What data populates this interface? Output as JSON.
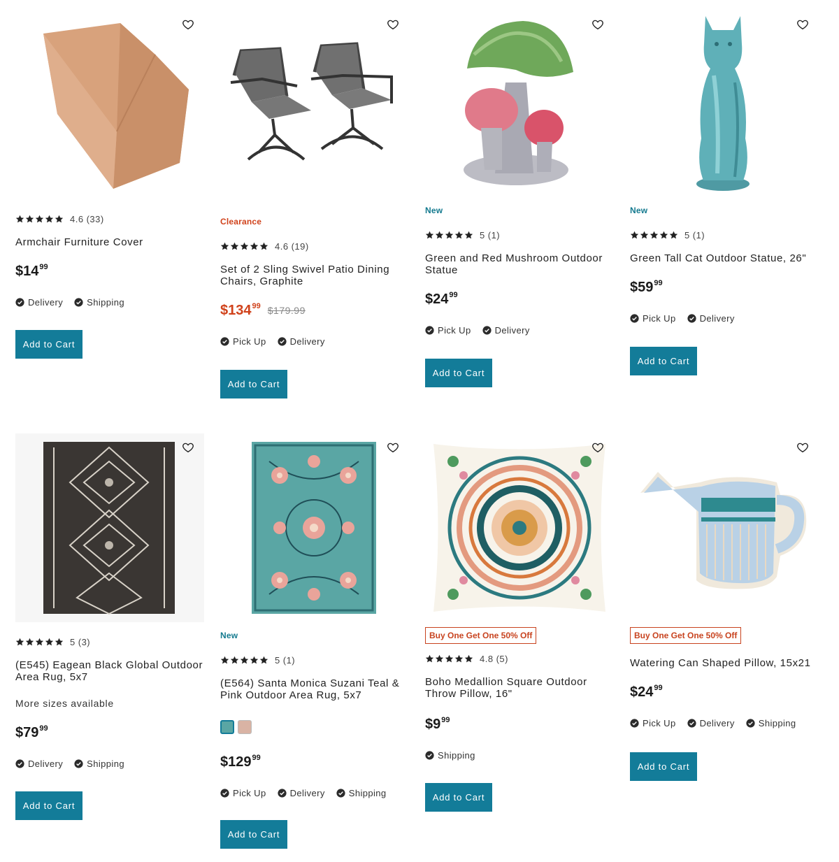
{
  "colors": {
    "accent": "#137c99",
    "sale": "#d0421b",
    "new": "#147a8f",
    "star": "#222222"
  },
  "icons": {
    "wishlist": "heart-outline-icon",
    "fulfillment": "check-circle-icon",
    "rating": "star-icon"
  },
  "products": [
    {
      "id": "armchair-cover",
      "badge": "",
      "rating": "4.6",
      "reviews": "(33)",
      "stars": 4.6,
      "title": "Armchair Furniture Cover",
      "more": "",
      "price_dollar": "$",
      "price_whole": "14",
      "price_cents": "99",
      "was": "",
      "fulfillment": [
        "Delivery",
        "Shipping"
      ],
      "button": "Add to Cart"
    },
    {
      "id": "swivel-chairs",
      "badge": "Clearance",
      "rating": "4.6",
      "reviews": "(19)",
      "stars": 4.6,
      "title": "Set of 2 Sling Swivel Patio Dining Chairs, Graphite",
      "more": "",
      "price_dollar": "$",
      "price_whole": "134",
      "price_cents": "99",
      "was": "$179.99",
      "fulfillment": [
        "Pick Up",
        "Delivery"
      ],
      "button": "Add to Cart"
    },
    {
      "id": "mushroom-statue",
      "badge": "New",
      "rating": "5",
      "reviews": "(1)",
      "stars": 5,
      "title": "Green and Red Mushroom Outdoor Statue",
      "more": "",
      "price_dollar": "$",
      "price_whole": "24",
      "price_cents": "99",
      "was": "",
      "fulfillment": [
        "Pick Up",
        "Delivery"
      ],
      "button": "Add to Cart"
    },
    {
      "id": "cat-statue",
      "badge": "New",
      "rating": "5",
      "reviews": "(1)",
      "stars": 5,
      "title": "Green Tall Cat Outdoor Statue, 26\"",
      "more": "",
      "price_dollar": "$",
      "price_whole": "59",
      "price_cents": "99",
      "was": "",
      "fulfillment": [
        "Pick Up",
        "Delivery"
      ],
      "button": "Add to Cart"
    },
    {
      "id": "eagean-rug",
      "badge": "",
      "rating": "5",
      "reviews": "(3)",
      "stars": 5,
      "title": "(E545) Eagean Black Global Outdoor Area Rug, 5x7",
      "more": "More sizes available",
      "price_dollar": "$",
      "price_whole": "79",
      "price_cents": "99",
      "was": "",
      "fulfillment": [
        "Delivery",
        "Shipping"
      ],
      "button": "Add to Cart"
    },
    {
      "id": "suzani-rug",
      "badge": "New",
      "rating": "5",
      "reviews": "(1)",
      "stars": 5,
      "title": "(E564) Santa Monica Suzani Teal & Pink Outdoor Area Rug, 5x7",
      "more": "",
      "price_dollar": "$",
      "price_whole": "129",
      "price_cents": "99",
      "was": "",
      "fulfillment": [
        "Pick Up",
        "Delivery",
        "Shipping"
      ],
      "button": "Add to Cart"
    },
    {
      "id": "medallion-pillow",
      "badge": "Buy One Get One 50% Off",
      "rating": "4.8",
      "reviews": "(5)",
      "stars": 4.8,
      "title": "Boho Medallion Square Outdoor Throw Pillow, 16\"",
      "more": "",
      "price_dollar": "$",
      "price_whole": "9",
      "price_cents": "99",
      "was": "",
      "fulfillment": [
        "Shipping"
      ],
      "button": "Add to Cart"
    },
    {
      "id": "watering-can-pillow",
      "badge": "Buy One Get One 50% Off",
      "rating": "",
      "reviews": "",
      "stars": 0,
      "title": "Watering Can Shaped Pillow, 15x21",
      "more": "",
      "price_dollar": "$",
      "price_whole": "24",
      "price_cents": "99",
      "was": "",
      "fulfillment": [
        "Pick Up",
        "Delivery",
        "Shipping"
      ],
      "button": "Add to Cart"
    }
  ]
}
